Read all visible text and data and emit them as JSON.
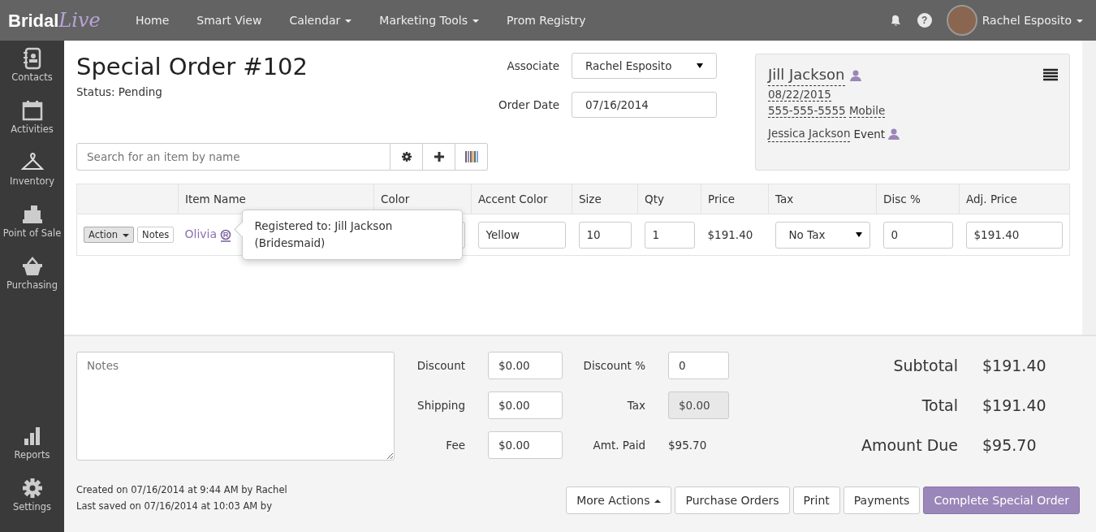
{
  "logo": {
    "text": "Bridal",
    "script": "Live"
  },
  "nav": [
    {
      "label": "Home",
      "dropdown": false
    },
    {
      "label": "Smart View",
      "dropdown": false
    },
    {
      "label": "Calendar",
      "dropdown": true
    },
    {
      "label": "Marketing Tools",
      "dropdown": true
    },
    {
      "label": "Prom Registry",
      "dropdown": false
    }
  ],
  "user": {
    "name": "Rachel Esposito"
  },
  "help": "?",
  "sidebar": {
    "top": [
      {
        "label": "Contacts"
      },
      {
        "label": "Activities"
      },
      {
        "label": "Inventory"
      },
      {
        "label": "Point of Sale"
      },
      {
        "label": "Purchasing"
      }
    ],
    "bottom": [
      {
        "label": "Reports"
      },
      {
        "label": "Settings"
      }
    ]
  },
  "order": {
    "title": "Special Order #102",
    "status": "Status: Pending"
  },
  "header_fields": [
    {
      "label": "Associate",
      "value": "Rachel Esposito",
      "kind": "select"
    },
    {
      "label": "Order Date",
      "value": "07/16/2014",
      "kind": "input"
    }
  ],
  "contact_card": {
    "name": "Jill Jackson",
    "date": "08/22/2015",
    "phone": "555-555-5555",
    "phone_type": "Mobile",
    "event_name": "Jessica Jackson",
    "event_label": "Event"
  },
  "search": {
    "placeholder": "Search for an item by name"
  },
  "table": {
    "columns": [
      "Item Name",
      "Color",
      "Accent Color",
      "Size",
      "Qty",
      "Price",
      "Tax",
      "Disc %",
      "Adj. Price"
    ],
    "rows": [
      {
        "action": "Action",
        "notes": "Notes",
        "item": "Olivia",
        "accent_color": "Yellow",
        "size": "10",
        "qty": "1",
        "price": "$191.40",
        "tax": "No Tax",
        "disc": "0",
        "adj_price": "$191.40"
      }
    ]
  },
  "tooltip": {
    "text": "Registered to: Jill Jackson",
    "role": "(Bridesmaid)"
  },
  "notes": {
    "placeholder": "Notes"
  },
  "fields": [
    {
      "label": "Discount",
      "value": "$0.00",
      "kind": "input"
    },
    {
      "label": "Discount %",
      "value": "0",
      "kind": "input"
    },
    {
      "label": "Shipping",
      "value": "$0.00",
      "kind": "input"
    },
    {
      "label": "Tax",
      "value": "$0.00",
      "kind": "readonly"
    },
    {
      "label": "Fee",
      "value": "$0.00",
      "kind": "input"
    },
    {
      "label": "Amt. Paid",
      "value": "$95.70",
      "kind": "text"
    }
  ],
  "summary": [
    {
      "label": "Subtotal",
      "value": "$191.40"
    },
    {
      "label": "Total",
      "value": "$191.40"
    },
    {
      "label": "Amount Due",
      "value": "$95.70"
    }
  ],
  "audit": [
    "Created on 07/16/2014 at 9:44 AM by Rachel",
    "Last saved on 07/16/2014 at 10:03 AM by"
  ],
  "actions": [
    {
      "label": "More Actions",
      "kind": "dropup"
    },
    {
      "label": "Purchase Orders",
      "kind": "default"
    },
    {
      "label": "Print",
      "kind": "default"
    },
    {
      "label": "Payments",
      "kind": "default"
    },
    {
      "label": "Complete Special Order",
      "kind": "primary"
    }
  ]
}
